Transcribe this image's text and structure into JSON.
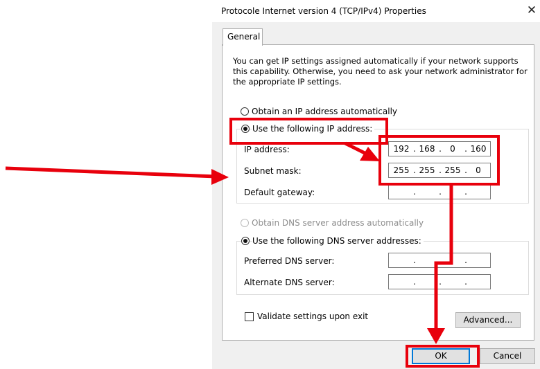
{
  "dialog": {
    "title": "Protocole Internet version 4 (TCP/IPv4) Properties",
    "close_glyph": "✕",
    "tabs": [
      {
        "label": "General",
        "selected": true
      }
    ],
    "description": "You can get IP settings assigned automatically if your network supports this capability. Otherwise, you need to ask your network administrator for the appropriate IP settings.",
    "ip_mode": {
      "auto_label": "Obtain an IP address automatically",
      "auto_selected": false,
      "manual_label": "Use the following IP address:",
      "manual_selected": true
    },
    "ip_fields": [
      {
        "label": "IP address:",
        "octets": [
          "192",
          "168",
          "0",
          "160"
        ]
      },
      {
        "label": "Subnet mask:",
        "octets": [
          "255",
          "255",
          "255",
          "0"
        ]
      },
      {
        "label": "Default gateway:",
        "octets": [
          "",
          "",
          "",
          ""
        ]
      }
    ],
    "dns_mode": {
      "auto_label": "Obtain DNS server address automatically",
      "auto_selected": false,
      "auto_disabled": true,
      "manual_label": "Use the following DNS server addresses:",
      "manual_selected": true
    },
    "dns_fields": [
      {
        "label": "Preferred DNS server:",
        "octets": [
          "",
          "",
          "",
          ""
        ]
      },
      {
        "label": "Alternate DNS server:",
        "octets": [
          "",
          "",
          "",
          ""
        ]
      }
    ],
    "validate": {
      "label": "Validate settings upon exit",
      "checked": false
    },
    "buttons": {
      "advanced": "Advanced...",
      "ok": "OK",
      "cancel": "Cancel"
    }
  },
  "annotation": {
    "color": "#e8000c"
  }
}
